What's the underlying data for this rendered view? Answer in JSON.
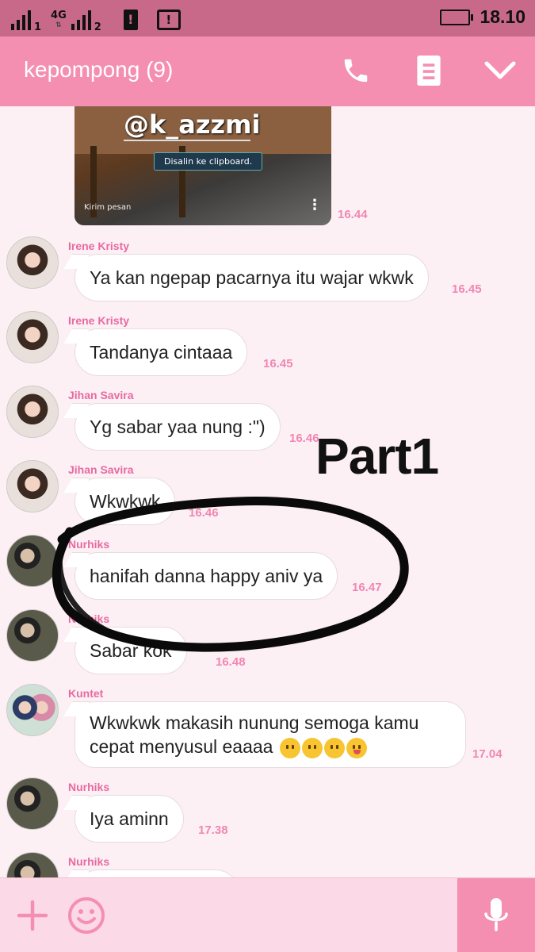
{
  "status_bar": {
    "sim1_label": "1",
    "sim2_label": "2",
    "network_type": "4G",
    "battery_icon": "battery-empty-icon",
    "time": "18.10"
  },
  "header": {
    "title": "kepompong (9)",
    "call_icon": "phone-icon",
    "notes_icon": "notes-icon",
    "menu_icon": "chevron-down-icon"
  },
  "image_message": {
    "handle_text": "@k_azzmi",
    "toast_text": "Disalin ke clipboard.",
    "caption": "Kirim pesan",
    "time": "16.44"
  },
  "messages": [
    {
      "sender": "Irene Kristy",
      "text": "Ya kan ngepap pacarnya itu wajar wkwk",
      "time": "16.45"
    },
    {
      "sender": "Irene Kristy",
      "text": "Tandanya cintaaa",
      "time": "16.45"
    },
    {
      "sender": "Jihan Savira",
      "text": "Yg sabar yaa nung :\")",
      "time": "16.46"
    },
    {
      "sender": "Jihan Savira",
      "text": "Wkwkwk",
      "time": "16.46"
    },
    {
      "sender": "Nurhiks",
      "text": "hanifah danna happy aniv ya",
      "time": "16.47"
    },
    {
      "sender": "Nurhiks",
      "text": "Sabar kok",
      "time": "16.48"
    },
    {
      "sender": "Kuntet",
      "text": "Wkwkwk makasih nunung semoga kamu cepat menyusul eaaaa",
      "time": "17.04"
    },
    {
      "sender": "Nurhiks",
      "text": "Iya aminn",
      "time": "17.38"
    },
    {
      "sender": "Nurhiks",
      "text": "",
      "time": ""
    }
  ],
  "overlay": {
    "text": "Part1"
  },
  "input_bar": {
    "add_icon": "plus-icon",
    "emoji_icon": "smiley-icon",
    "mic_icon": "microphone-icon"
  },
  "colors": {
    "header": "#f48fb1",
    "status_bar": "#c8698a",
    "sender_name": "#e76aa1",
    "timestamp": "#f186b2",
    "chat_background": "#fdf0f4"
  }
}
